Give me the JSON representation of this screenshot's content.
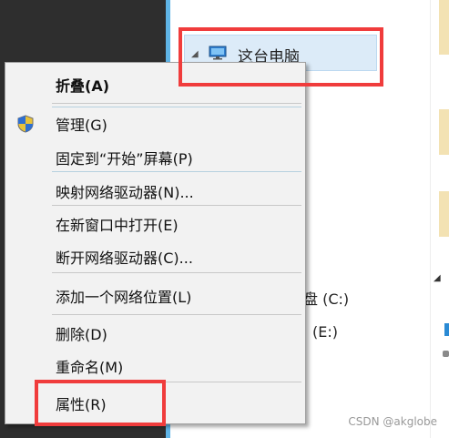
{
  "explorer": {
    "tree_item_label": "这台电脑",
    "drive_c_label": "盘 (C:)",
    "drive_e_label": "(E:)"
  },
  "context_menu": {
    "items": [
      {
        "label": "折叠(A)",
        "bold": true
      },
      {
        "label": "管理(G)",
        "icon": "uac-shield-icon"
      },
      {
        "label": "固定到“开始”屏幕(P)"
      },
      {
        "label": "映射网络驱动器(N)..."
      },
      {
        "label": "在新窗口中打开(E)"
      },
      {
        "label": "断开网络驱动器(C)..."
      },
      {
        "label": "添加一个网络位置(L)"
      },
      {
        "label": "删除(D)"
      },
      {
        "label": "重命名(M)"
      },
      {
        "label": "属性(R)"
      }
    ]
  },
  "watermark": "CSDN @akglobe",
  "colors": {
    "highlight_box": "#f03c3c",
    "tree_selection": "#dcebf8",
    "menu_background": "#f2f2f2",
    "dark_panel": "#2e2e2e"
  }
}
